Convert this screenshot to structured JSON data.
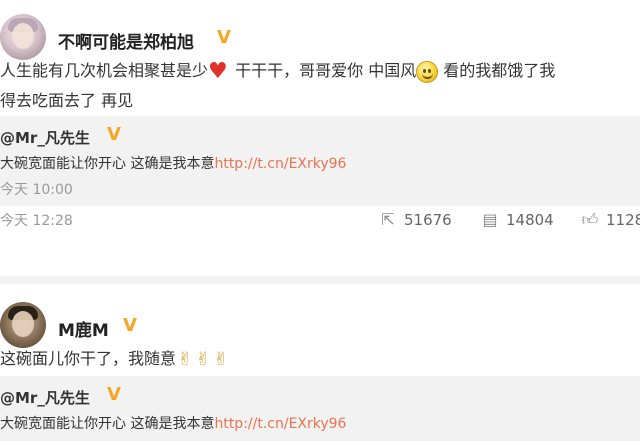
{
  "posts": [
    {
      "username": "不啊可能是郑柏旭",
      "text": {
        "line1_a": "人生能有几次机会相聚甚是少",
        "line1_b": "干干干，哥哥爱你 中国风",
        "line1_c": "看的我都饿了我",
        "line2": "得去吃面去了 再见"
      },
      "repost": {
        "user": "@Mr_凡先生",
        "text": "大碗宽面能让你开心 这确是我本意",
        "link": "http://t.cn/EXrky96",
        "time": "今天 10:00"
      },
      "time": "今天 12:28",
      "actions": {
        "repost_count": "51676",
        "comment_count": "14804",
        "like_count": "1128"
      }
    },
    {
      "username": "M鹿M",
      "text": "这碗面儿你干了，我随意",
      "repost": {
        "user": "@Mr_凡先生",
        "text": "大碗宽面能让你开心 这确是我本意",
        "link": "http://t.cn/EXrky96"
      }
    }
  ],
  "icons": {
    "verified": "verified-badge-icon",
    "heart": "heart-emoji-icon",
    "smiley": "smiley-emoji-icon",
    "victory": "victory-hand-emoji-icon",
    "repost": "repost-icon",
    "comment": "comment-icon",
    "like": "thumbs-up-icon"
  },
  "colors": {
    "link": "#eb7350",
    "verified": "#f5a623",
    "repost_bg": "#f2f2f2",
    "meta_text": "#999999"
  }
}
